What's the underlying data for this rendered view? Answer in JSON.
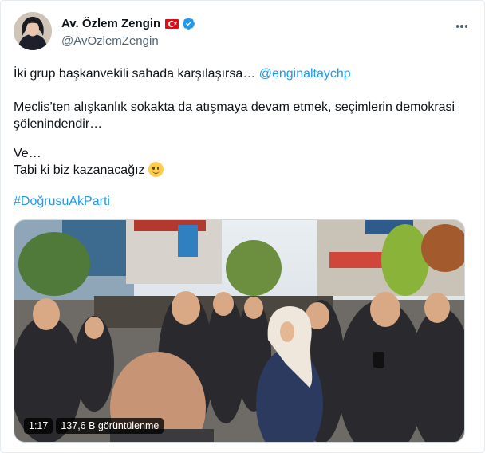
{
  "author": {
    "display_name": "Av. Özlem Zengin",
    "handle": "@AvOzlemZengin",
    "flag": "Turkish flag",
    "verified_badge": "verified-badge-icon"
  },
  "tweet": {
    "line1_text": "İki grup başkanvekili sahada karşılaşırsa… ",
    "mention": "@enginaltaychp",
    "para2": "Meclis’ten alışkanlık sokakta da atışmaya devam etmek, seçimlerin demokrasi şölenindendir…",
    "para3_line1": "Ve…",
    "para3_line2": "Tabi ki biz kazanacağız",
    "emoji": "slightly-smiling-face",
    "hashtag": "#DoğrusuAkParti"
  },
  "video": {
    "duration": "1:17",
    "views": "137,6 B görüntülenme"
  },
  "colors": {
    "accent": "#1d9bf0",
    "text": "#0f1419",
    "secondary": "#536471",
    "flag_red": "#e30a17"
  }
}
